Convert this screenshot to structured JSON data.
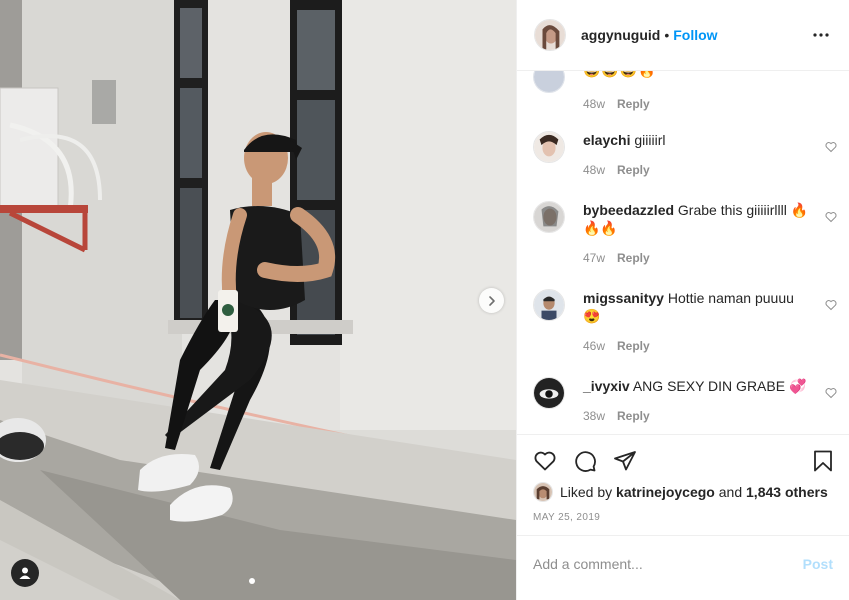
{
  "header": {
    "username": "aggynuguid",
    "separator": "•",
    "follow_label": "Follow",
    "more_icon": "more-horizontal-icon"
  },
  "comments": [
    {
      "user": "",
      "text": "😅😅😅🔥",
      "time": "48w",
      "reply_label": "Reply",
      "partial": true
    },
    {
      "user": "elaychi",
      "text": "giiiiirl",
      "time": "48w",
      "reply_label": "Reply"
    },
    {
      "user": "bybeedazzled",
      "text": "Grabe this giiiiirllll 🔥🔥🔥",
      "time": "47w",
      "reply_label": "Reply"
    },
    {
      "user": "migssanityy",
      "text": "Hottie naman puuuu 😍",
      "time": "46w",
      "reply_label": "Reply"
    },
    {
      "user": "_ivyxiv",
      "text": "ANG SEXY DIN GRABE 💞",
      "time": "38w",
      "reply_label": "Reply"
    }
  ],
  "actions": {
    "like_icon": "heart-icon",
    "comment_icon": "comment-icon",
    "share_icon": "paper-plane-icon",
    "save_icon": "bookmark-icon"
  },
  "likes": {
    "prefix": "Liked by",
    "user": "katrinejoycego",
    "joiner": "and",
    "others": "1,843 others"
  },
  "date": "MAY 25, 2019",
  "add_comment": {
    "placeholder": "Add a comment...",
    "post_label": "Post"
  },
  "colors": {
    "accent": "#0095f6",
    "post_disabled": "#b2dffc",
    "muted": "#8e8e8e",
    "text": "#262626"
  }
}
